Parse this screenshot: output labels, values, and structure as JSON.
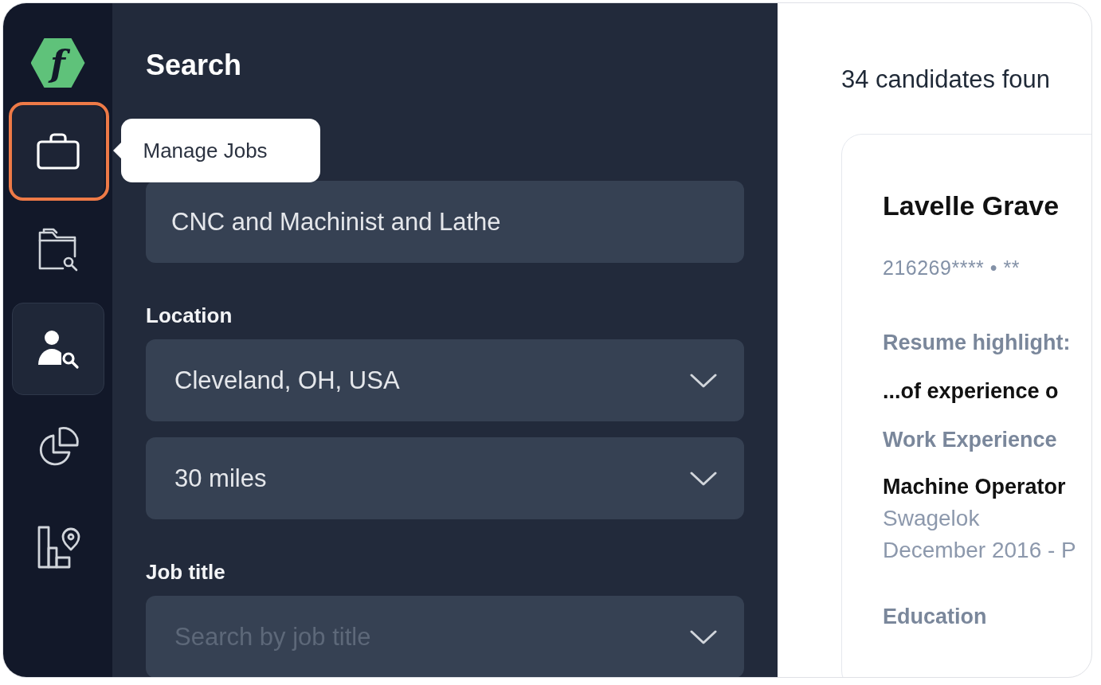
{
  "sidebar": {
    "logo_text": "f",
    "items": [
      {
        "kind": "briefcase",
        "selected": false,
        "highlighted": true,
        "tooltip": "Manage Jobs"
      },
      {
        "kind": "folder",
        "selected": false,
        "highlighted": false
      },
      {
        "kind": "person",
        "selected": true,
        "highlighted": false
      },
      {
        "kind": "pie",
        "selected": false,
        "highlighted": false
      },
      {
        "kind": "building",
        "selected": false,
        "highlighted": false
      }
    ]
  },
  "panel": {
    "title": "Search",
    "fields": [
      {
        "kind": "text",
        "value": "CNC and Machinist and Lathe"
      },
      {
        "kind": "select",
        "label": "Location",
        "value": "Cleveland, OH, USA"
      },
      {
        "kind": "select",
        "value": "30 miles"
      },
      {
        "kind": "select",
        "label": "Job title",
        "placeholder": "Search by job title"
      }
    ]
  },
  "results": {
    "count_text": "34 candidates foun",
    "card": {
      "name": "Lavelle Grave",
      "meta": "216269**** • **",
      "highlight_label": "Resume highlight:",
      "highlight_text": "...of experience o",
      "sections": [
        {
          "title": "Work Experience",
          "entries": [
            {
              "title": "Machine Operator",
              "company": "Swagelok",
              "dates": "December 2016 - P"
            }
          ]
        },
        {
          "title": "Education"
        }
      ]
    }
  }
}
